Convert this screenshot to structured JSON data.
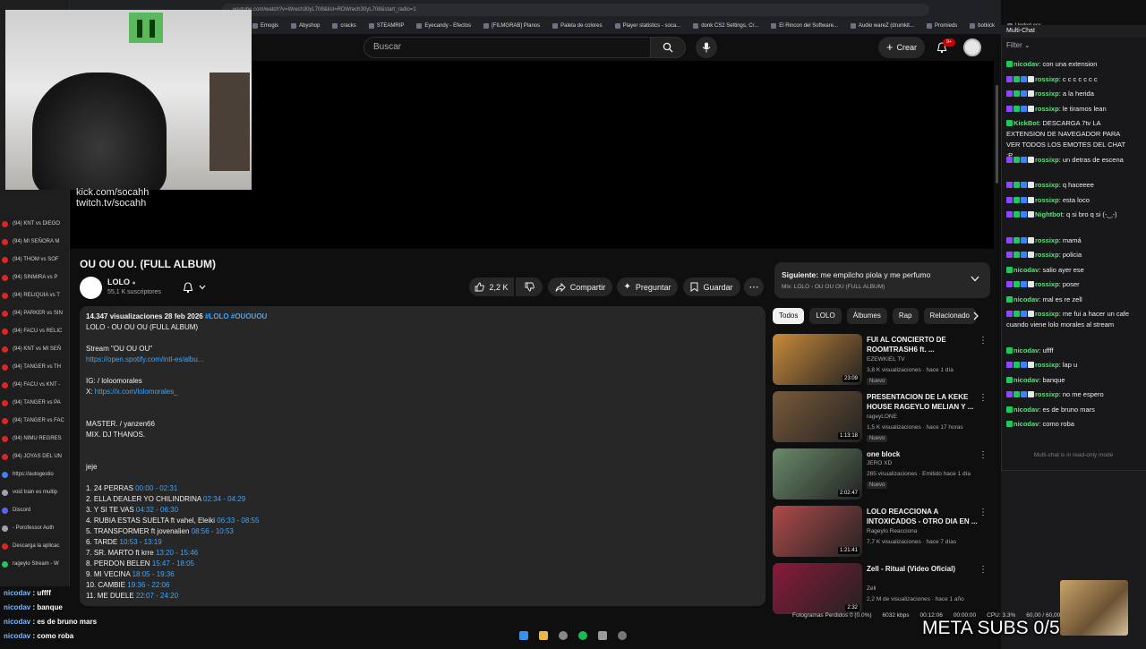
{
  "browser": {
    "url": "youtube.com/watch?v=Wrech30yL708&list=RDWrech30yL708&start_radio=1",
    "zoom": "120%",
    "bookmarks": [
      "Emogis",
      "Abyshop",
      "cracks",
      "STEAMRIP",
      "Eyecandy - Efectos",
      "[FILMGRAB] Planos",
      "Paleta de colores",
      "Player statistics - soca...",
      "donk CS2 Settings, Cr...",
      "El Rincon del Software...",
      "Audio wareZ (drumkit...",
      "Promieds",
      "botkick",
      "UnderLess"
    ]
  },
  "sidebar_tabs": [
    {
      "label": "(94) KNT vs DIEGO",
      "color": "#e02424"
    },
    {
      "label": "(94) MI SEÑORA M",
      "color": "#e02424"
    },
    {
      "label": "(94) THOM vs SOF",
      "color": "#e02424"
    },
    {
      "label": "(94) SINMIRA vs P",
      "color": "#e02424"
    },
    {
      "label": "(94) RELIQUIA vs T",
      "color": "#e02424"
    },
    {
      "label": "(94) PARKER vs SIN",
      "color": "#e02424"
    },
    {
      "label": "(94) FACU vs RELIC",
      "color": "#e02424"
    },
    {
      "label": "(94) KNT vs MI SEÑ",
      "color": "#e02424"
    },
    {
      "label": "(94) TANGER vs TH",
      "color": "#e02424"
    },
    {
      "label": "(94) FACU vs KNT -",
      "color": "#e02424"
    },
    {
      "label": "(94) TANGER vs PA",
      "color": "#e02424"
    },
    {
      "label": "(94) TANGER vs FAC",
      "color": "#e02424"
    },
    {
      "label": "(94) NIMU REGRES",
      "color": "#e02424"
    },
    {
      "label": "(94) JOYAS DEL UN",
      "color": "#e02424"
    },
    {
      "label": "https://autogestio",
      "color": "#3b82f6"
    },
    {
      "label": "void train es multip",
      "color": "#9ca3af"
    },
    {
      "label": "Discord",
      "color": "#5865f2"
    },
    {
      "label": "- Porofessor Auth",
      "color": "#9ca3af"
    },
    {
      "label": "Descarga la aplicac",
      "color": "#e02424"
    },
    {
      "label": "rageylo Stream - W",
      "color": "#22c55e"
    }
  ],
  "header": {
    "search_placeholder": "Buscar",
    "create_label": "Crear",
    "notif_count": "9+"
  },
  "player": {
    "overlay_line1": "kick.com/socahh",
    "overlay_line2": "twitch.tv/socahh"
  },
  "video": {
    "title": "OU OU OU. (FULL ALBUM)",
    "channel": "LOLO",
    "subscribers": "55,1 K suscriptores",
    "likes": "2,2 K",
    "share_label": "Compartir",
    "ask_label": "Preguntar",
    "save_label": "Guardar"
  },
  "description": {
    "stats": "14.347 visualizaciones  28 feb 2026",
    "hashtags": "#LOLO #OUOUOU",
    "lines": [
      {
        "text": "LOLO - OU OU OU (FULL ALBUM)",
        "link": ""
      },
      {
        "text": "Stream \"OU OU OU\"",
        "link": ""
      },
      {
        "text": "",
        "link": "https://open.spotify.com/intl-es/albu..."
      },
      {
        "text": "IG:   / loloomorales",
        "link": ""
      },
      {
        "text": "X: ",
        "link": "https://x.com/lolomorales_"
      },
      {
        "text": "MASTER.   / yanzen66",
        "link": ""
      },
      {
        "text": "MIX. DJ THANOS.",
        "link": ""
      },
      {
        "text": "jeje",
        "link": ""
      }
    ],
    "tracks": [
      {
        "title": "1. 24 PERRAS",
        "time": "00:00 - 02:31"
      },
      {
        "title": "2. ELLA DEALER YO CHILINDRINA",
        "time": "02:34 - 04:29"
      },
      {
        "title": "3. Y SI TE VAS",
        "time": "04:32 - 06:30"
      },
      {
        "title": "4. RUBIA ESTAS SUELTA ft vahel, Eleiki",
        "time": "06:33 - 08:55"
      },
      {
        "title": "5. TRANSFORMER ft jovenalien",
        "time": "08:56 - 10:53"
      },
      {
        "title": "6. TARDE",
        "time": "10:53 - 13:19"
      },
      {
        "title": "7. SR. MARTO ft krre",
        "time": "13:20 - 15:46"
      },
      {
        "title": "8. PERDON BELEN",
        "time": "15:47 - 18:05"
      },
      {
        "title": "9. MI VECINA",
        "time": "18:05 - 19:36"
      },
      {
        "title": "10. CAMBIE",
        "time": "19:36 - 22:06"
      },
      {
        "title": "11. ME DUELE",
        "time": "22:07 - 24:20"
      }
    ]
  },
  "up_next": {
    "label": "Siguiente:",
    "title": "me empilcho piola y me perfumo",
    "sub": "Mix: LOLO - OU OU OU (FULL ALBUM)"
  },
  "chips": [
    "Todos",
    "LOLO",
    "Álbumes",
    "Rap",
    "Relacionado"
  ],
  "recommendations": [
    {
      "title": "FUI AL CONCIERTO DE ROOMTRASH6 ft. ...",
      "channel": "EZEWKIEL TV",
      "meta": "3,8 K visualizaciones · hace 1 día",
      "badge": "Nuevo",
      "duration": "23:09",
      "color": "#c98a3a"
    },
    {
      "title": "PRESENTACION DE LA KEKE HOUSE RAGEYLO MELIAN Y ...",
      "channel": "rageyLONE",
      "meta": "1,5 K visualizaciones · hace 17 horas",
      "badge": "Nuevo",
      "duration": "1:13:18",
      "color": "#7a5a3a"
    },
    {
      "title": "one block",
      "channel": "JERO XD",
      "meta": "265 visualizaciones · Emitido hace 1 día",
      "badge": "Nuevo",
      "duration": "2:02:47",
      "color": "#6a8a6a"
    },
    {
      "title": "LOLO REACCIONA A INTOXICADOS - OTRO DIA EN ...",
      "channel": "Rageylo Reacciona",
      "meta": "7,7 K visualizaciones · hace 7 días",
      "badge": "",
      "duration": "1:21:41",
      "color": "#b04a4a"
    },
    {
      "title": "Zell - Ritual (Video Oficial)",
      "channel": "Zell",
      "meta": "2,2 M de visualizaciones · hace 1 año",
      "badge": "",
      "duration": "2:32",
      "color": "#8a1a3a"
    }
  ],
  "chat": {
    "title": "Multi-Chat",
    "filter": "Filter",
    "readonly": "Multi-chat is in read-only mode",
    "messages": [
      {
        "user": "nicodav",
        "text": ": con una extension",
        "color": "#5de07a"
      },
      {
        "user": "rossixp",
        "text": ": c c c c c c c",
        "color": "#5de07a"
      },
      {
        "user": "rossixp",
        "text": ": a la herida",
        "color": "#5de07a"
      },
      {
        "user": "rossixp",
        "text": ": le tiramos lean",
        "color": "#5de07a"
      },
      {
        "user": "KickBot",
        "text": ": DESCARGA 7tv LA EXTENSION DE NAVEGADOR PARA VER TODOS LOS EMOTES DEL CHAT :P",
        "color": "#5de07a"
      },
      {
        "user": "rossixp",
        "text": ": un detras de escena",
        "color": "#5de07a"
      },
      {
        "user": "rossixp",
        "text": ": q haceeee",
        "color": "#5de07a"
      },
      {
        "user": "rossixp",
        "text": ": esta loco",
        "color": "#5de07a"
      },
      {
        "user": "Nightbot",
        "text": ": q si bro q si (-‿-)",
        "color": "#5de07a"
      },
      {
        "user": "rossixp",
        "text": ": mamá",
        "color": "#5de07a"
      },
      {
        "user": "rossixp",
        "text": ": policia",
        "color": "#5de07a"
      },
      {
        "user": "nicodav",
        "text": ": salio ayer ese",
        "color": "#5de07a"
      },
      {
        "user": "rossixp",
        "text": ": poser",
        "color": "#5de07a"
      },
      {
        "user": "nicodav",
        "text": ": mal es re zell",
        "color": "#5de07a"
      },
      {
        "user": "rossixp",
        "text": ": me fui a hacer un cafe cuando viene lolo morales al stream",
        "color": "#5de07a"
      },
      {
        "user": "nicodav",
        "text": ": uffff",
        "color": "#5de07a"
      },
      {
        "user": "rossixp",
        "text": ": lap u",
        "color": "#5de07a"
      },
      {
        "user": "nicodav",
        "text": ": banque",
        "color": "#5de07a"
      },
      {
        "user": "rossixp",
        "text": ": no me espero",
        "color": "#5de07a"
      },
      {
        "user": "nicodav",
        "text": ": es de bruno mars",
        "color": "#5de07a"
      },
      {
        "user": "nicodav",
        "text": ": como roba",
        "color": "#5de07a"
      }
    ]
  },
  "overlay_chat": [
    {
      "user": "nicodav",
      "text": " : uffff"
    },
    {
      "user": "nicodav",
      "text": " : banque"
    },
    {
      "user": "nicodav",
      "text": " : es de bruno mars"
    },
    {
      "user": "nicodav",
      "text": " : como roba"
    }
  ],
  "status": {
    "frames": "Fotogramas Perdidos 0 (0.0%)",
    "bitrate": "6032 kbps",
    "time1": "00:12:06",
    "time2": "00:00:00",
    "cpu": "CPU: 3.3%",
    "fps": "60,00 / 60,00 FPS"
  },
  "meta_subs": "META SUBS 0/5"
}
